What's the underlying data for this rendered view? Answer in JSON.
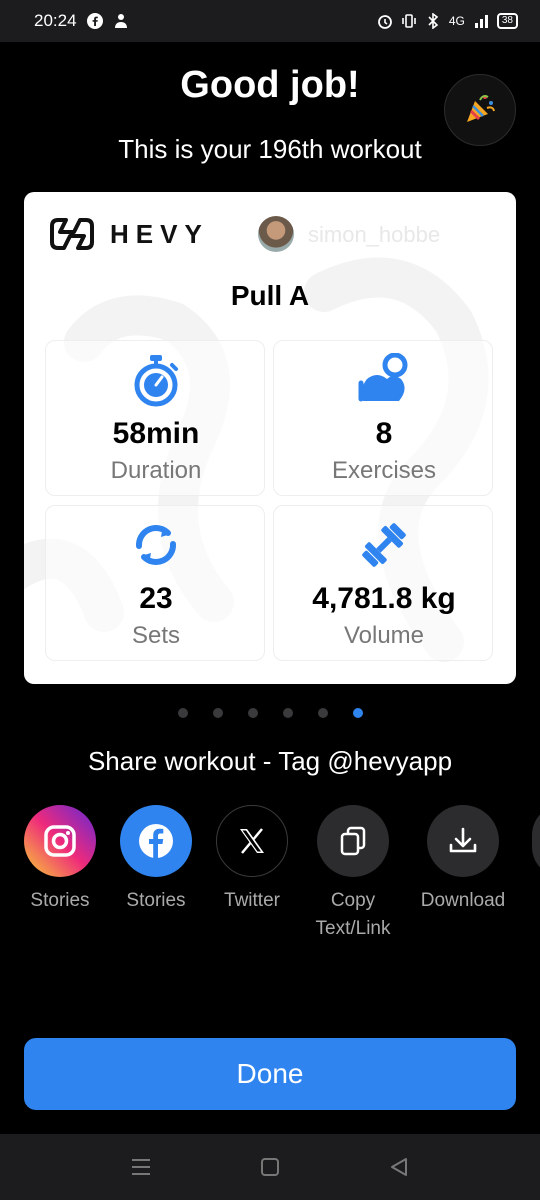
{
  "status_bar": {
    "time": "20:24",
    "network": "4G",
    "battery": "38",
    "icons": [
      "facebook-icon",
      "notification-icon",
      "alarm-icon",
      "vibrate-icon",
      "bluetooth-icon",
      "signal-icon",
      "battery-icon"
    ]
  },
  "header": {
    "title": "Good job!",
    "subtitle": "This is your 196th workout",
    "party_icon": "party-popper-icon"
  },
  "card": {
    "brand": "HEVY",
    "username": "simon_hobbe",
    "workout_name": "Pull A",
    "stats": [
      {
        "value": "58min",
        "label": "Duration",
        "icon": "stopwatch-icon"
      },
      {
        "value": "8",
        "label": "Exercises",
        "icon": "muscle-icon"
      },
      {
        "value": "23",
        "label": "Sets",
        "icon": "repeat-icon"
      },
      {
        "value": "4,781.8 kg",
        "label": "Volume",
        "icon": "dumbbell-icon"
      }
    ]
  },
  "pager": {
    "count": 6,
    "active_index": 5
  },
  "share": {
    "title": "Share workout - Tag @hevyapp",
    "items": [
      {
        "label": "Stories",
        "icon": "instagram-icon"
      },
      {
        "label": "Stories",
        "icon": "facebook-icon"
      },
      {
        "label": "Twitter",
        "icon": "x-icon"
      },
      {
        "label": "Copy Text/Link",
        "icon": "copy-icon"
      },
      {
        "label": "Download",
        "icon": "download-icon"
      }
    ]
  },
  "done_label": "Done",
  "colors": {
    "accent": "#2f84ef",
    "background": "#000000",
    "card": "#ffffff"
  }
}
